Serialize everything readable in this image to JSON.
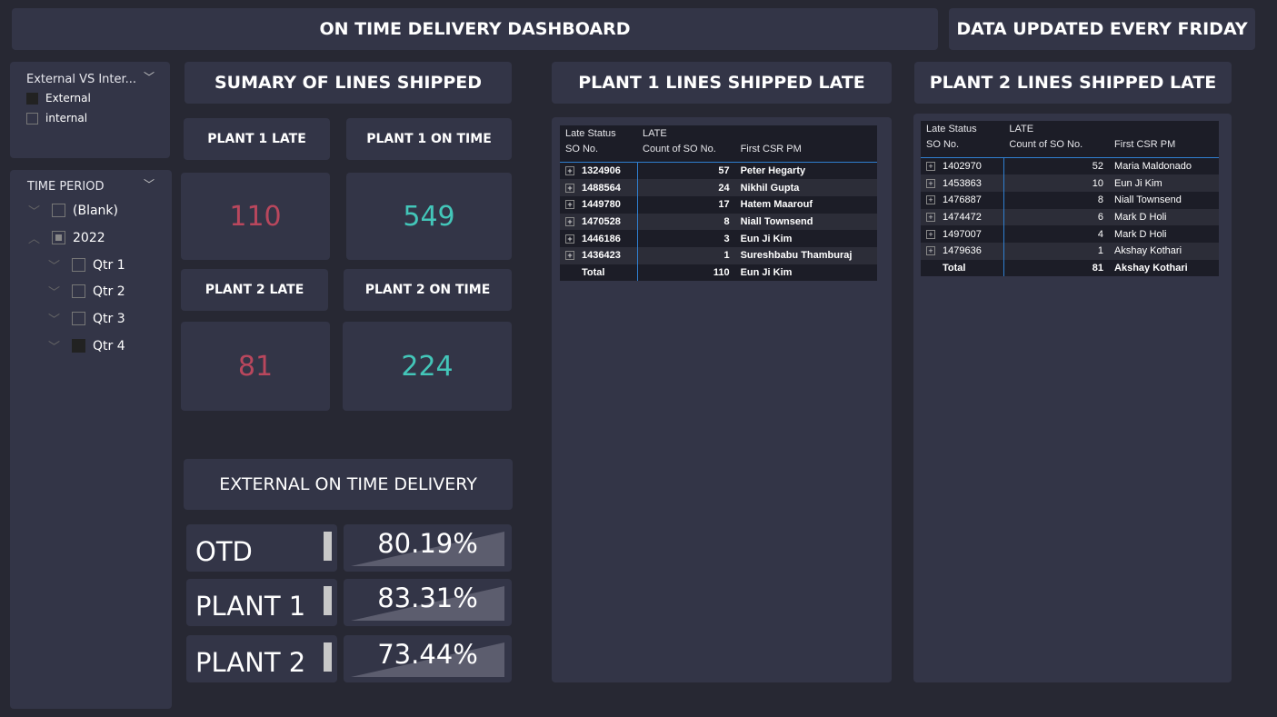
{
  "header": {
    "title": "ON TIME DELIVERY DASHBOARD",
    "update_note": "DATA UPDATED EVERY FRIDAY"
  },
  "slicer_type": {
    "title": "External VS Inter...",
    "options": [
      {
        "label": "External",
        "checked": true
      },
      {
        "label": "internal",
        "checked": false
      }
    ]
  },
  "slicer_time": {
    "title": "TIME PERIOD",
    "items": [
      {
        "label": "(Blank)"
      },
      {
        "label": "2022"
      },
      {
        "label": "Qtr 1"
      },
      {
        "label": "Qtr 2"
      },
      {
        "label": "Qtr 3"
      },
      {
        "label": "Qtr 4"
      }
    ]
  },
  "summary": {
    "title": "SUMARY OF LINES SHIPPED",
    "cards": [
      {
        "label": "PLANT 1 LATE",
        "value": "110"
      },
      {
        "label": "PLANT 1 ON TIME",
        "value": "549"
      },
      {
        "label": "PLANT 2 LATE",
        "value": "81"
      },
      {
        "label": "PLANT 2 ON TIME",
        "value": "224"
      }
    ]
  },
  "otd": {
    "title": "EXTERNAL ON TIME DELIVERY",
    "rows": [
      {
        "label": "OTD",
        "value": "80.19%",
        "fraction": 0.8019
      },
      {
        "label": "PLANT 1",
        "value": "83.31%",
        "fraction": 0.8331
      },
      {
        "label": "PLANT 2",
        "value": "73.44%",
        "fraction": 0.7344
      }
    ]
  },
  "columns": {
    "late_status": "Late Status",
    "late": "LATE",
    "so": "SO No.",
    "count": "Count of SO No.",
    "csr": "First CSR PM",
    "total": "Total"
  },
  "plant1": {
    "title": "PLANT 1 LINES SHIPPED LATE",
    "rows": [
      [
        "1324906",
        "57",
        "Peter Hegarty"
      ],
      [
        "1488564",
        "24",
        "Nikhil Gupta"
      ],
      [
        "1449780",
        "17",
        "Hatem Maarouf"
      ],
      [
        "1470528",
        "8",
        "Niall Townsend"
      ],
      [
        "1446186",
        "3",
        "Eun Ji Kim"
      ],
      [
        "1436423",
        "1",
        "Sureshbabu Thamburaj"
      ]
    ],
    "total": [
      "110",
      "Eun Ji Kim"
    ]
  },
  "plant2": {
    "title": "PLANT 2 LINES SHIPPED LATE",
    "rows": [
      [
        "1402970",
        "52",
        "Maria Maldonado"
      ],
      [
        "1453863",
        "10",
        "Eun Ji Kim"
      ],
      [
        "1476887",
        "8",
        "Niall Townsend"
      ],
      [
        "1474472",
        "6",
        "Mark D Holi"
      ],
      [
        "1497007",
        "4",
        "Mark D Holi"
      ],
      [
        "1479636",
        "1",
        "Akshay Kothari"
      ]
    ],
    "total": [
      "81",
      "Akshay Kothari"
    ]
  }
}
